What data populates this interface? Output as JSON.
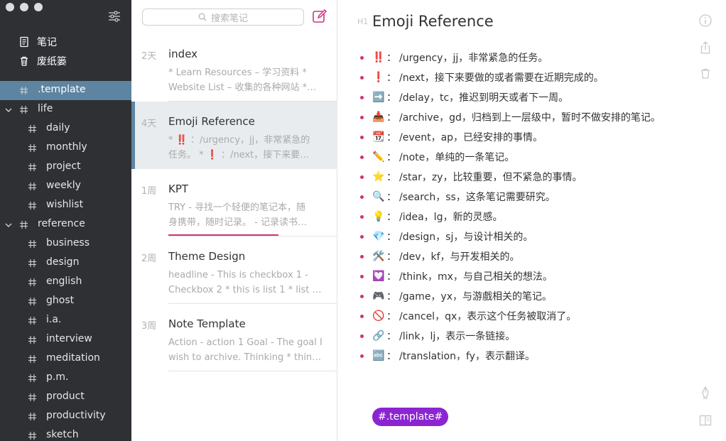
{
  "sidebar": {
    "top_items": [
      {
        "label": "笔记",
        "icon": "note-icon"
      },
      {
        "label": "废纸篓",
        "icon": "trash-icon"
      }
    ],
    "tags": [
      {
        "label": ".template",
        "level": 0,
        "active": true,
        "expandable": false
      },
      {
        "label": "life",
        "level": 0,
        "active": false,
        "expandable": true
      },
      {
        "label": "daily",
        "level": 1
      },
      {
        "label": "monthly",
        "level": 1
      },
      {
        "label": "project",
        "level": 1
      },
      {
        "label": "weekly",
        "level": 1
      },
      {
        "label": "wishlist",
        "level": 1
      },
      {
        "label": "reference",
        "level": 0,
        "active": false,
        "expandable": true
      },
      {
        "label": "business",
        "level": 1
      },
      {
        "label": "design",
        "level": 1
      },
      {
        "label": "english",
        "level": 1
      },
      {
        "label": "ghost",
        "level": 1
      },
      {
        "label": "i.a.",
        "level": 1
      },
      {
        "label": "interview",
        "level": 1
      },
      {
        "label": "meditation",
        "level": 1
      },
      {
        "label": "p.m.",
        "level": 1
      },
      {
        "label": "product",
        "level": 1
      },
      {
        "label": "productivity",
        "level": 1
      },
      {
        "label": "sketch",
        "level": 1
      }
    ]
  },
  "notelist": {
    "search_placeholder": "搜索笔记",
    "notes": [
      {
        "age": "2天",
        "title": "index",
        "preview1": "* Learn Resources – 学习资料 *",
        "preview2": "Website List – 收集的各种网站 *…",
        "selected": false
      },
      {
        "age": "4天",
        "title": "Emoji Reference",
        "preview1": "* ‼️ ：/urgency，jj，非常紧急的",
        "preview2": "任务。 * ❗ ：/next，接下来要…",
        "selected": true
      },
      {
        "age": "1周",
        "title": "KPT",
        "preview1": "TRY - 寻找一个轻便的笔记本，随",
        "preview2": "身携带，随时记录。 - 记录读书…",
        "selected": false
      },
      {
        "age": "2周",
        "title": "Theme Design",
        "preview1": "headline - This is checkbox 1 -",
        "preview2": "Checkbox 2 * this is list 1 * list 2…",
        "selected": false
      },
      {
        "age": "3周",
        "title": "Note Template",
        "preview1": "Action - action 1 Goal - The goal I",
        "preview2": "wish to archive. Thinking * think…",
        "selected": false
      }
    ]
  },
  "editor": {
    "heading_marker": "H1",
    "title": "Emoji Reference",
    "items": [
      {
        "emoji": "‼️",
        "text": "/urgency，jj，非常紧急的任务。"
      },
      {
        "emoji": "❗",
        "text": "/next，接下来要做的或者需要在近期完成的。"
      },
      {
        "emoji": "➡️",
        "text": "/delay，tc，推迟到明天或者下一周。"
      },
      {
        "emoji": "📥",
        "text": "/archive，gd，归档到上一层级中，暂时不做安排的笔记。"
      },
      {
        "emoji": "📆",
        "text": "/event，ap，已经安排的事情。"
      },
      {
        "emoji": "✏️",
        "text": "/note，单纯的一条笔记。"
      },
      {
        "emoji": "⭐",
        "text": "/star，zy，比较重要，但不紧急的事情。"
      },
      {
        "emoji": "🔍",
        "text": "/search，ss，这条笔记需要研究。"
      },
      {
        "emoji": "💡",
        "text": "/idea，lg，新的灵感。"
      },
      {
        "emoji": "💎",
        "text": "/design，sj，与设计相关的。"
      },
      {
        "emoji": "🛠️",
        "text": "/dev，kf，与开发相关的。"
      },
      {
        "emoji": "💟",
        "text": "/think，mx，与自己相关的想法。"
      },
      {
        "emoji": "🎮",
        "text": "/game，yx，与游戲相关的笔记。"
      },
      {
        "emoji": "🚫",
        "text": "/cancel，qx，表示这个任务被取消了。"
      },
      {
        "emoji": "🔗",
        "text": "/link，lj，表示一条链接。"
      },
      {
        "emoji": "🔤",
        "text": "/translation，fy，表示翻译。"
      }
    ],
    "tag": "#.template#"
  },
  "colors": {
    "sidebar_bg": "#2e3033",
    "sidebar_active": "#5d84a1",
    "bullet": "#d1327b",
    "tag_pill": "#8c25d1"
  }
}
